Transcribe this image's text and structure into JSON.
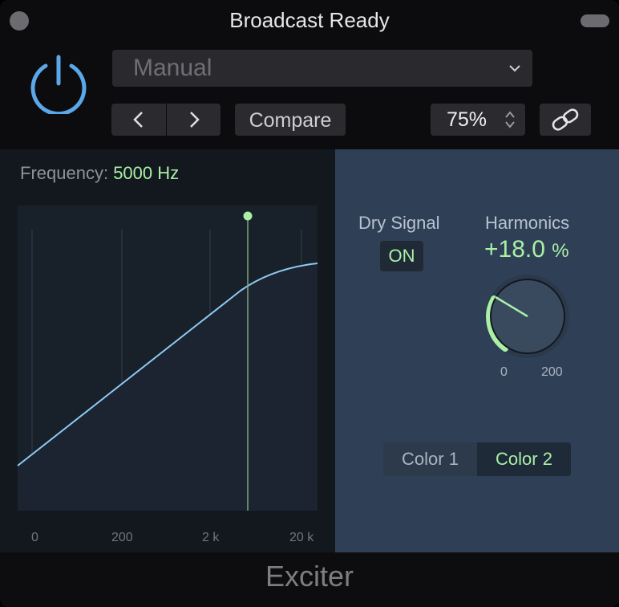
{
  "window": {
    "title": "Broadcast Ready"
  },
  "header": {
    "preset": "Manual",
    "compare_label": "Compare",
    "zoom": "75%"
  },
  "graph": {
    "frequency_label": "Frequency:",
    "frequency_value": "5000 Hz",
    "x_ticks": [
      "0",
      "200",
      "2 k",
      "20 k"
    ]
  },
  "controls": {
    "dry_signal_label": "Dry Signal",
    "dry_signal_state": "ON",
    "harmonics_label": "Harmonics",
    "harmonics_value": "+18.0",
    "harmonics_unit": "%",
    "harmonics_min": "0",
    "harmonics_max": "200",
    "color1_label": "Color 1",
    "color2_label": "Color 2",
    "selected_color": "Color 2"
  },
  "footer": {
    "plugin_name": "Exciter"
  },
  "colors": {
    "accent_green": "#a9f0a6",
    "power_blue": "#5aa7ea",
    "curve_blue": "#8fcaf5"
  }
}
